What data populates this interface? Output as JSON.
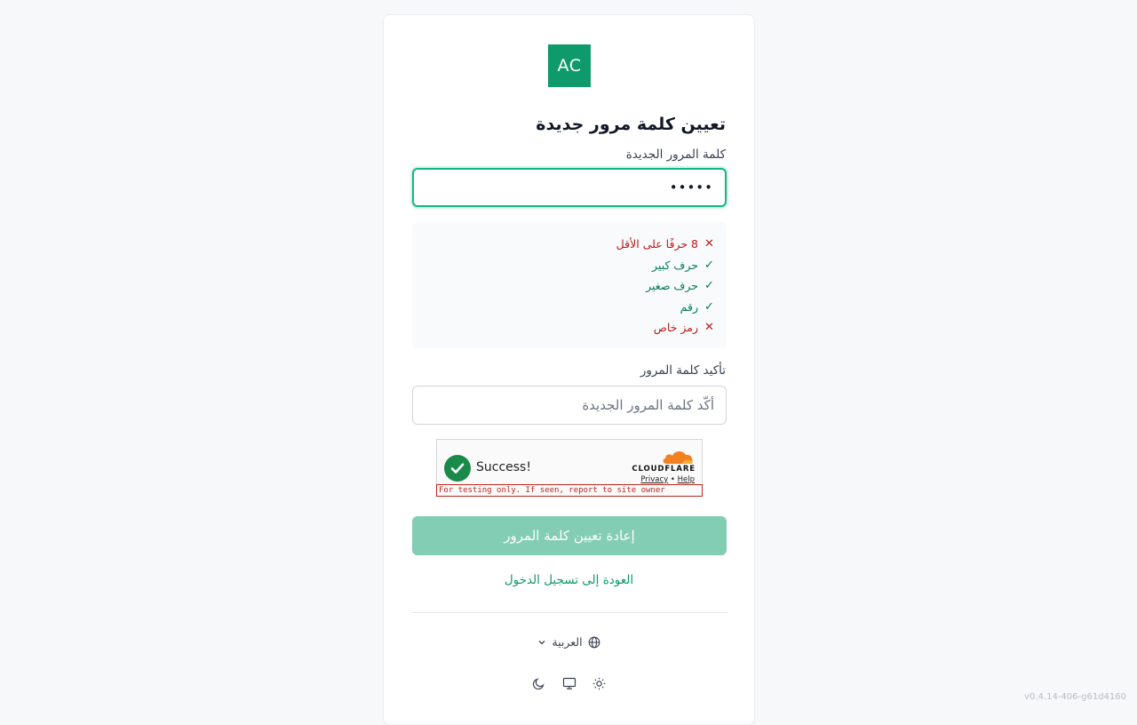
{
  "logo": {
    "text": "AC",
    "color": "#0e9a6a"
  },
  "form": {
    "title": "تعيين كلمة مرور جديدة",
    "new_password_label": "كلمة المرور الجديدة",
    "new_password_value": "•••••",
    "confirm_label": "تأكيد كلمة المرور",
    "confirm_placeholder": "أكّد كلمة المرور الجديدة",
    "confirm_value": "",
    "submit_label": "إعادة تعيين كلمة المرور",
    "back_link": "العودة إلى تسجيل الدخول"
  },
  "requirements": [
    {
      "label": "8 حرفًا على الأقل",
      "status": "fail",
      "icon": "x-icon",
      "mark": "✕"
    },
    {
      "label": "حرف كبير",
      "status": "pass",
      "icon": "check-icon",
      "mark": "✓"
    },
    {
      "label": "حرف صغير",
      "status": "pass",
      "icon": "check-icon",
      "mark": "✓"
    },
    {
      "label": "رقم",
      "status": "pass",
      "icon": "check-icon",
      "mark": "✓"
    },
    {
      "label": "رمز خاص",
      "status": "fail",
      "icon": "x-icon",
      "mark": "✕"
    }
  ],
  "captcha": {
    "status_text": "Success!",
    "brand": "CLOUDFLARE",
    "privacy_link": "Privacy",
    "separator": "•",
    "help_link": "Help",
    "warning": "For testing only. If seen, report to site owner"
  },
  "footer": {
    "language_label": "العربية",
    "language_icon": "globe-icon",
    "theme_icons": [
      "moon-icon",
      "monitor-icon",
      "sun-icon"
    ]
  },
  "version": "v0.4.14-406-g61d4160",
  "colors": {
    "accent": "#0e9a6a",
    "accent_disabled": "#82cdb3",
    "focus_ring": "#10b981",
    "fail": "#b91c1c",
    "pass": "#047857"
  }
}
